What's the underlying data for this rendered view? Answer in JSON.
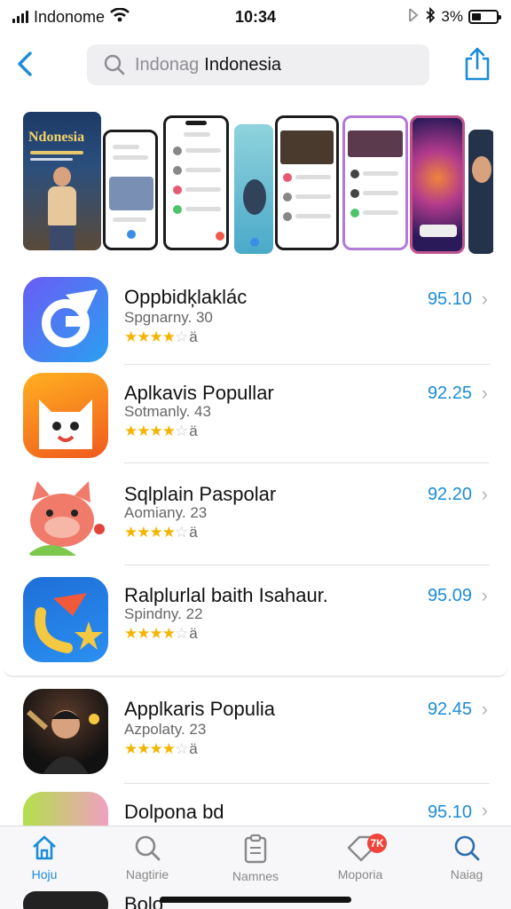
{
  "status_bar": {
    "carrier": "Indonome",
    "time": "10:34",
    "battery_text": "3%"
  },
  "nav": {
    "search_placeholder": "Indonag",
    "search_query": "Indonesia"
  },
  "carousel": {
    "poster_title": "Ndonesia"
  },
  "apps": [
    {
      "name": "Oppbidķlaklác",
      "sub": "Spgnarny. 30",
      "stars_text": "★★★★",
      "stars_off": "☆",
      "rating_num": "ä",
      "price": "95.10",
      "icon": "g-arrow-icon",
      "color": "#6a5cf5"
    },
    {
      "name": "Aplkavis Popullar",
      "sub": "Sotmanly. 43",
      "stars_text": "★★★★",
      "stars_off": "☆",
      "rating_num": "ä",
      "price": "92.25",
      "icon": "cat-face-icon",
      "color": "#f7931e"
    },
    {
      "name": "Sqlplain Paspolar",
      "sub": "Aomiany. 23",
      "stars_text": "★★★★",
      "stars_off": "☆",
      "rating_num": "ä",
      "price": "92.20",
      "icon": "pig-mascot-icon",
      "color": "#f07b6a"
    },
    {
      "name": "Ralplurlal baith Isahaur.",
      "sub": "Spindny. 22",
      "stars_text": "★★★★",
      "stars_off": "☆",
      "rating_num": "ä",
      "price": "95.09",
      "icon": "star-swoosh-icon",
      "color": "#1f6fd8"
    },
    {
      "name": "Applkaris Populia",
      "sub": "Azpolaty. 23",
      "stars_text": "★★★★",
      "stars_off": "☆",
      "rating_num": "ä",
      "price": "92.45",
      "icon": "performer-photo-icon",
      "color": "#111111"
    },
    {
      "name": "Dolpona bd",
      "sub": "",
      "stars_text": "",
      "stars_off": "",
      "rating_num": "",
      "price": "95.10",
      "icon": "colorful-n-icon",
      "color": "#b3e04a"
    }
  ],
  "tabs": [
    {
      "label": "Hoju",
      "icon": "home-icon",
      "active": true
    },
    {
      "label": "Nagtirie",
      "icon": "search-icon",
      "active": false
    },
    {
      "label": "Namnes",
      "icon": "clipboard-icon",
      "active": false
    },
    {
      "label": "Moporia",
      "icon": "tag-icon",
      "active": false,
      "badge": "7K"
    },
    {
      "label": "Naiag",
      "icon": "search-icon",
      "active": false
    }
  ],
  "peek_text": "Bolo",
  "colors": {
    "accent": "#1a8cd8",
    "star": "#f5b400",
    "badge": "#f0433a"
  }
}
